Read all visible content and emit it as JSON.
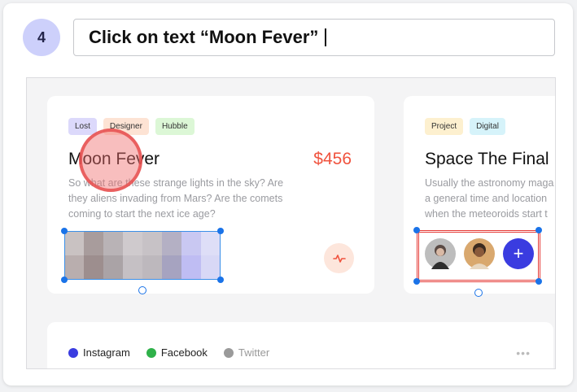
{
  "step": {
    "number": "4",
    "instruction": "Click on text “Moon Fever”"
  },
  "card1": {
    "tags": [
      {
        "label": "Lost",
        "bg": "#dcd9fb"
      },
      {
        "label": "Designer",
        "bg": "#fde3d4"
      },
      {
        "label": "Hubble",
        "bg": "#dcf7d6"
      }
    ],
    "title": "Moon Fever",
    "price": "$456",
    "description": "So what are these strange lights in the sky? Are\nthey aliens invading from Mars? Are the comets\ncoming to start the next ice age?",
    "action_icon": "activity-icon"
  },
  "card2": {
    "tags": [
      {
        "label": "Project",
        "bg": "#fdf0cf"
      },
      {
        "label": "Digital",
        "bg": "#d6f3fa"
      }
    ],
    "title": "Space The Final F",
    "description": "Usually the astronomy maga\na general time and location\nwhen the meteoroids start t",
    "add_label": "+"
  },
  "legend": [
    {
      "label": "Instagram",
      "color": "#3a3ce0"
    },
    {
      "label": "Facebook",
      "color": "#2fb14a"
    },
    {
      "label": "Twitter",
      "color": "#9a9a9a"
    }
  ],
  "more_label": "•••",
  "colors": {
    "accent": "#3a3ce0",
    "price": "#f0533e",
    "selection": "#1a73e8",
    "highlight": "#e53935"
  }
}
